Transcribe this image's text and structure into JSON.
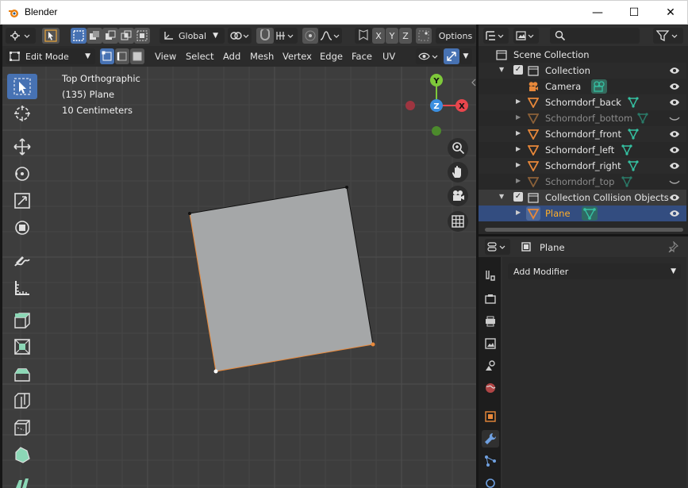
{
  "window": {
    "title": "Blender",
    "minimize": "—",
    "maximize": "☐",
    "close": "✕"
  },
  "viewport": {
    "header": {
      "orientation": "Global",
      "options_label": "Options",
      "axis_x": "X",
      "axis_y": "Y",
      "axis_z": "Z"
    },
    "header2": {
      "mode": "Edit Mode",
      "menus": [
        "View",
        "Select",
        "Add",
        "Mesh",
        "Vertex",
        "Edge",
        "Face",
        "UV"
      ]
    },
    "overlay": {
      "view_name": "Top Orthographic",
      "object_info": "(135) Plane",
      "scale_info": "10 Centimeters"
    },
    "gizmo": {
      "y_label": "Y",
      "z_label": "Z",
      "x_label": "X"
    }
  },
  "outliner": {
    "root": "Scene Collection",
    "items": [
      {
        "label": "Collection",
        "kind": "collection"
      },
      {
        "label": "Camera",
        "kind": "camera"
      },
      {
        "label": "Schorndorf_back",
        "kind": "mesh"
      },
      {
        "label": "Schorndorf_bottom",
        "kind": "mesh",
        "hidden": true
      },
      {
        "label": "Schorndorf_front",
        "kind": "mesh"
      },
      {
        "label": "Schorndorf_left",
        "kind": "mesh"
      },
      {
        "label": "Schorndorf_right",
        "kind": "mesh"
      },
      {
        "label": "Schorndorf_top",
        "kind": "mesh",
        "hidden": true
      },
      {
        "label": "Collection Collision Objects",
        "kind": "collection"
      },
      {
        "label": "Plane",
        "kind": "mesh",
        "selected": true
      }
    ]
  },
  "properties": {
    "object_name": "Plane",
    "add_modifier": "Add Modifier"
  },
  "colors": {
    "accent": "#4772b3",
    "axis_x": "#e8464d",
    "axis_y": "#7ec93a",
    "axis_z": "#3b8fe0",
    "mesh_orange": "#e8883a",
    "mesh_teal": "#35c1a2",
    "selected_text": "#ffaf29"
  }
}
